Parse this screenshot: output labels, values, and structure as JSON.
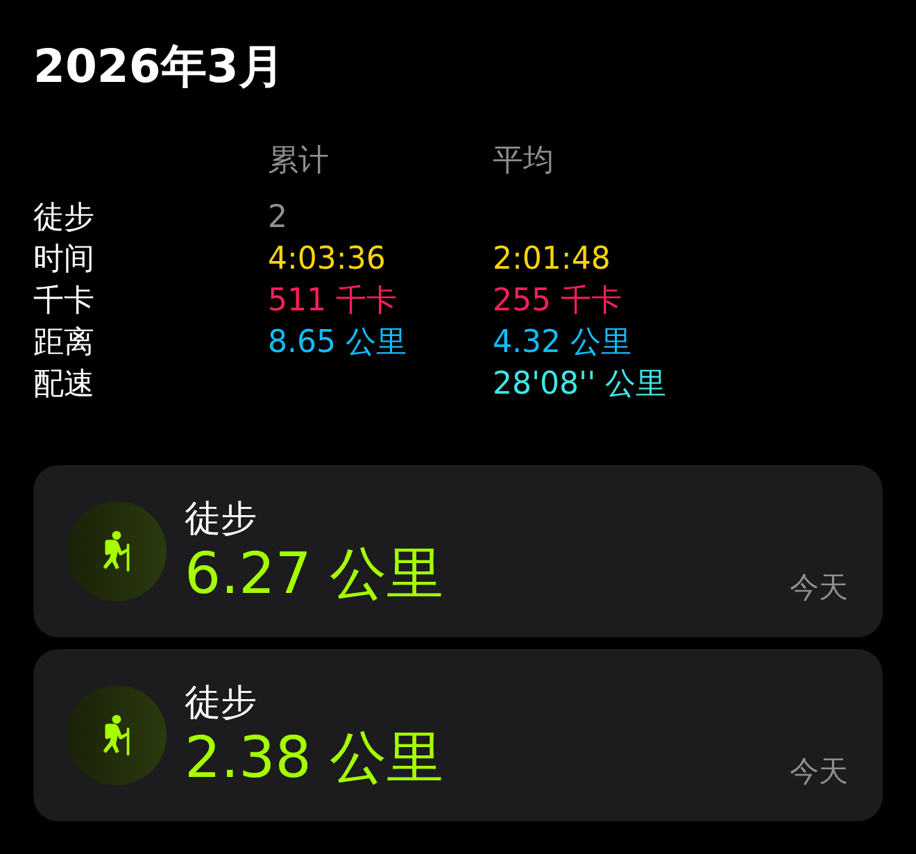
{
  "title": "2026年3月",
  "stats": {
    "columns": [
      "累计",
      "平均"
    ],
    "rows": [
      {
        "label": "徒步",
        "total": "2",
        "average": null,
        "color": "#8e8e93"
      },
      {
        "label": "时间",
        "total": "4:03:36",
        "average": "2:01:48",
        "color": "#ffd60a"
      },
      {
        "label": "千卡",
        "total": "511 千卡",
        "average": "255 千卡",
        "color": "#ff1f5a"
      },
      {
        "label": "距离",
        "total": "8.65 公里",
        "average": "4.32 公里",
        "color": "#12bdfa"
      },
      {
        "label": "配速",
        "total": null,
        "average": "28'08'' 公里",
        "color": "#3fe6e6"
      }
    ]
  },
  "workouts": [
    {
      "kind": "hiking",
      "name": "徒步",
      "distance": "6.27 公里",
      "date": "今天"
    },
    {
      "kind": "hiking",
      "name": "徒步",
      "distance": "2.38 公里",
      "date": "今天"
    }
  ]
}
